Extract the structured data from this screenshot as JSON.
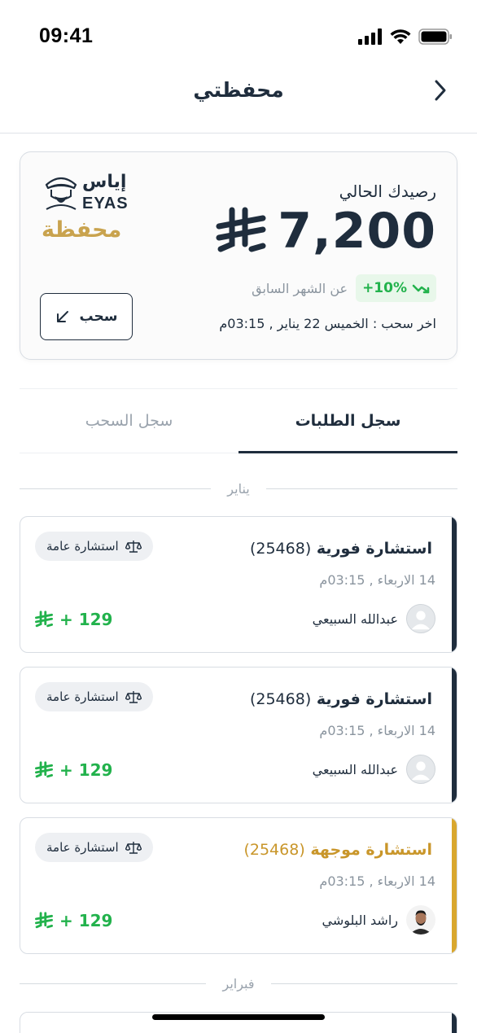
{
  "status": {
    "time": "09:41"
  },
  "nav": {
    "title": "محفظتي"
  },
  "wallet": {
    "balance_label": "رصيدك الحالي",
    "balance_amount": "7,200",
    "growth_value": "+10%",
    "growth_caption": "عن الشهر السابق",
    "last_withdraw": "اخر سحب : الخميس 22 يناير , 03:15م",
    "withdraw_label": "سحب",
    "brand_ar": "إياس",
    "brand_en": "EYAS",
    "brand_sub": "محفظة"
  },
  "tabs": [
    {
      "label": "سجل الطلبات",
      "active": true
    },
    {
      "label": "سجل السحب",
      "active": false
    }
  ],
  "months": [
    "يناير",
    "فبراير"
  ],
  "transactions": [
    {
      "title": "استشارة فورية",
      "code": "(25468)",
      "date": "14 الاربعاء , 03:15م",
      "user": "عبدالله السبيعي",
      "amount": "+ 129",
      "badge": "استشارة عامة",
      "accent": "#1f2d3d"
    },
    {
      "title": "استشارة فورية",
      "code": "(25468)",
      "date": "14 الاربعاء , 03:15م",
      "user": "عبدالله السبيعي",
      "amount": "+ 129",
      "badge": "استشارة عامة",
      "accent": "#1f2d3d"
    },
    {
      "title": "استشارة موجهة",
      "code": "(25468)",
      "date": "14 الاربعاء , 03:15م",
      "user": "راشد البلوشي",
      "amount": "+ 129",
      "badge": "استشارة عامة",
      "accent": "#d9a72e"
    }
  ],
  "colors": {
    "primary": "#1f2d3d",
    "gold": "#c9a34e",
    "green": "#22b24c",
    "orange_accent": "#d9a72e"
  }
}
